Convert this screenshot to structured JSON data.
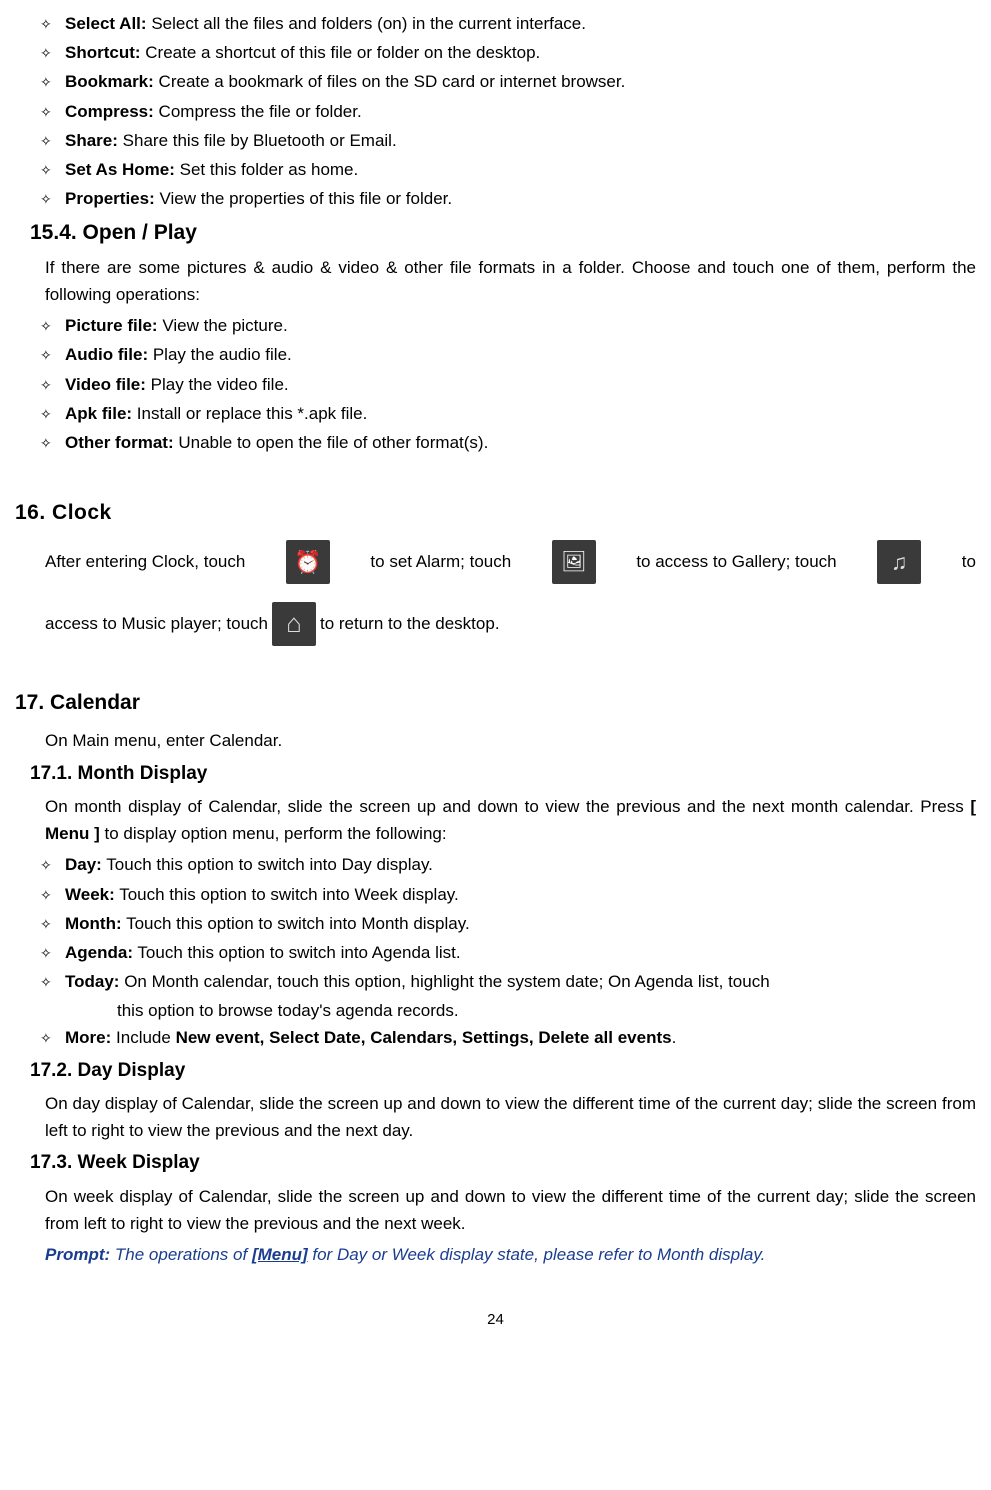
{
  "top_list": [
    {
      "term": "Select All:",
      "desc": "Select all the files and folders (on) in the current interface."
    },
    {
      "term": "Shortcut:",
      "desc": "Create a shortcut of this file or folder on the desktop."
    },
    {
      "term": "Bookmark:",
      "desc": "Create a bookmark of files on the SD card or internet browser."
    },
    {
      "term": "Compress:",
      "desc": "Compress the file or folder."
    },
    {
      "term": "Share:",
      "desc": "Share this file by Bluetooth or Email."
    },
    {
      "term": "Set As Home:",
      "desc": "Set this folder as home."
    },
    {
      "term": "Properties:",
      "desc": "View the properties of this file or folder."
    }
  ],
  "sec_15_4": {
    "heading": "15.4.  Open / Play",
    "intro": "If there are some pictures & audio & video & other file formats in a folder. Choose and touch one of them, perform the following operations:",
    "items": [
      {
        "term": "Picture file:",
        "desc": "View the picture."
      },
      {
        "term": "Audio file:",
        "desc": "Play the audio file."
      },
      {
        "term": "Video file:",
        "desc": "Play the video file."
      },
      {
        "term": "Apk file:",
        "desc": "Install or replace this *.apk file."
      },
      {
        "term": "Other format:",
        "desc": "Unable to open the file of other format(s)."
      }
    ]
  },
  "sec_16": {
    "heading": "16.   Clock",
    "t1": "After entering Clock, touch",
    "t2": "to set Alarm; touch",
    "t3": "to access to Gallery; touch",
    "t4": "to",
    "t5": "access to Music player; touch",
    "t6": "to return to the desktop."
  },
  "sec_17": {
    "heading": "17. Calendar",
    "intro": "On Main menu, enter Calendar."
  },
  "sec_17_1": {
    "heading": "17.1. Month Display",
    "intro_p1": "On month display of Calendar, slide the screen up and down to view the previous and the next month calendar. Press ",
    "intro_bold": "[ Menu ]",
    "intro_p2": " to display option menu, perform the following:",
    "items": [
      {
        "term": "Day:",
        "desc": "Touch this option to switch into Day display."
      },
      {
        "term": "Week:",
        "desc": "Touch this option to switch into Week display."
      },
      {
        "term": "Month:",
        "desc": "Touch this option to switch into Month display."
      },
      {
        "term": "Agenda:",
        "desc": "Touch this option to switch into Agenda list."
      },
      {
        "term": "Today:",
        "desc": "On Month calendar, touch this option, highlight the system date; On Agenda list, touch",
        "desc2": "this option to browse today's agenda records."
      },
      {
        "term": "More:",
        "desc": "Include ",
        "bold": "New event, Select Date, Calendars, Settings, Delete all events",
        "after": "."
      }
    ]
  },
  "sec_17_2": {
    "heading": "17.2. Day Display",
    "body": "On day display of Calendar, slide the screen up and down to view the different time of the current day; slide the screen from left to right to view the previous and the next day."
  },
  "sec_17_3": {
    "heading": "17.3.  Week Display",
    "body": "On week display of Calendar, slide the screen up and down to view the different time of the current day; slide the screen from left to right to view the previous and the next week.",
    "prompt_label": "Prompt:",
    "prompt_p1": " The operations of ",
    "prompt_bold": "[Menu]",
    "prompt_p2": " for Day or Week display state, please refer to Month display."
  },
  "page_number": "24"
}
